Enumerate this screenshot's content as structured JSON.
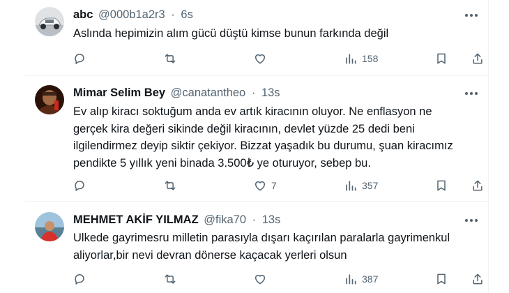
{
  "tweets": [
    {
      "name": "abc",
      "handle": "@000b1a2r3",
      "dot": "·",
      "time": "6s",
      "text": "Aslında hepimizin alım gücü düştü kimse bunun farkında değil",
      "likes": "",
      "views": "158"
    },
    {
      "name": "Mimar Selim Bey",
      "handle": "@canatantheo",
      "dot": "·",
      "time": "13s",
      "text": "Ev alıp kiracı soktuğum anda ev artık kiracının oluyor. Ne enflasyon ne\ngerçek kira değeri sikinde değil kiracının, devlet yüzde 25 dedi beni\nilgilendirmez deyip siktir çekiyor. Bizzat yaşadık bu durumu, şuan kiracımız\npendikte 5 yıllık yeni binada 3.500₺ ye oturuyor, sebep bu.",
      "likes": "7",
      "views": "357"
    },
    {
      "name": "MEHMET AKİF YILMAZ",
      "handle": "@fika70",
      "dot": "·",
      "time": "13s",
      "text": "Ulkede gayrimesru milletin parasıyla dışarı kaçırılan paralarla gayrimenkul\naliyorlar,bir nevi devran dönerse kaçacak yerleri olsun",
      "likes": "",
      "views": "387"
    }
  ],
  "icons": {
    "reply": "reply-icon",
    "retweet": "retweet-icon",
    "like": "heart-icon",
    "views": "views-icon",
    "bookmark": "bookmark-icon",
    "share": "share-icon",
    "more": "more-icon"
  },
  "colors": {
    "text": "#0f1419",
    "secondary": "#536471",
    "divider": "#eff3f4"
  }
}
